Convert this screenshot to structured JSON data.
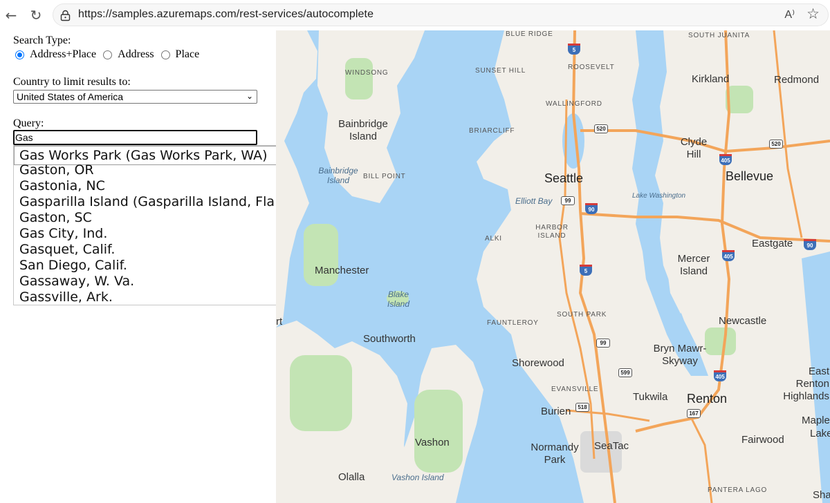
{
  "browser": {
    "url": "https://samples.azuremaps.com/rest-services/autocomplete",
    "back_icon": "back-arrow-icon",
    "refresh_icon": "refresh-icon",
    "read_aloud_label": "A⁾",
    "favorite_icon": "star-icon"
  },
  "panel": {
    "search_type_label": "Search Type:",
    "radio_options": [
      "Address+Place",
      "Address",
      "Place"
    ],
    "radio_selected": "Address+Place",
    "country_label": "Country to limit results to:",
    "country_value": "United States of America",
    "query_label": "Query:",
    "query_value": "Gas"
  },
  "suggestions": [
    "Gas Works Park (Gas Works Park, WA)",
    "Gaston, OR",
    "Gastonia, NC",
    "Gasparilla Island (Gasparilla Island, Fla.)",
    "Gaston, SC",
    "Gas City, Ind.",
    "Gasquet, Calif.",
    "San Diego, Calif.",
    "Gassaway, W. Va.",
    "Gassville, Ark."
  ],
  "map": {
    "labels": {
      "blue_ridge": "BLUE RIDGE",
      "south_juanita": "SOUTH JUANITA",
      "windsong": "WINDSONG",
      "sunset_hill": "SUNSET HILL",
      "roosevelt": "ROOSEVELT",
      "kirkland": "Kirkland",
      "redmond": "Redmond",
      "wallingford": "WALLINGFORD",
      "bainbridge_island": "Bainbridge Island",
      "briarcliff": "BRIARCLIFF",
      "clyde_hill": "Clyde Hill",
      "bainbridge_water": "Bainbridge Island",
      "bill_point": "BILL POINT",
      "seattle": "Seattle",
      "bellevue": "Bellevue",
      "elliott_bay": "Elliott Bay",
      "lake_washington": "Lake Washington",
      "harbor_island": "HARBOR ISLAND",
      "alki": "ALKI",
      "eastgate": "Eastgate",
      "mercer_island": "Mercer Island",
      "manchester": "Manchester",
      "blake_island": "Blake Island",
      "south_park": "SOUTH PARK",
      "fauntleroy": "FAUNTLEROY",
      "newcastle": "Newcastle",
      "southworth": "Southworth",
      "bryn_mawr": "Bryn Mawr-Skyway",
      "shorewood": "Shorewood",
      "east_renton": "East Renton Highlands",
      "evansville": "EVANSVILLE",
      "tukwila": "Tukwila",
      "renton": "Renton",
      "burien": "Burien",
      "maple": "Maple",
      "lake_cut": "Lake",
      "vashon": "Vashon",
      "normandy_park": "Normandy Park",
      "seatac": "SeaTac",
      "fairwood": "Fairwood",
      "olalla": "Olalla",
      "vashon_island": "Vashon Island",
      "pantera_lago": "PANTERA LAGO",
      "sha": "Sha",
      "rt": "rt"
    },
    "shields": {
      "i5_north": "5",
      "sr520_west": "520",
      "sr520_east": "520",
      "i405_north": "405",
      "sr99_north": "99",
      "i90_west": "90",
      "i90_east": "90",
      "i405_mid": "405",
      "i5_south": "5",
      "sr99_south": "99",
      "sr599": "599",
      "i405_south": "405",
      "sr518": "518",
      "sr167": "167"
    },
    "colors": {
      "water": "#a9d4f5",
      "land": "#f2efe9",
      "park": "#c3e4b4",
      "highway": "#f3a55a"
    }
  }
}
